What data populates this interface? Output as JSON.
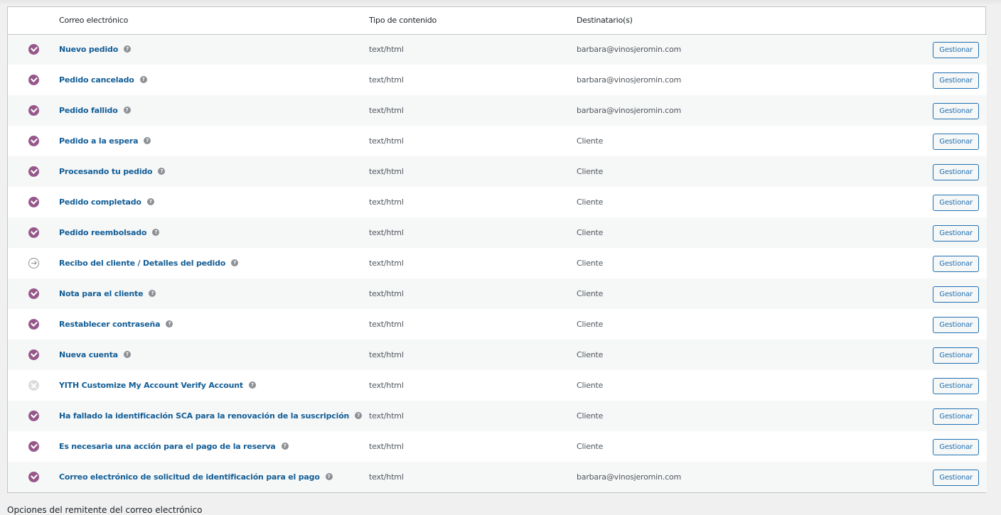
{
  "table": {
    "headers": {
      "status": "",
      "email": "Correo electrónico",
      "type": "Tipo de contenido",
      "recipients": "Destinatario(s)",
      "actions": ""
    },
    "rows": [
      {
        "status": "enabled",
        "name": "Nuevo pedido",
        "type": "text/html",
        "recipient": "barbara@vinosjeromin.com",
        "action": "Gestionar"
      },
      {
        "status": "enabled",
        "name": "Pedido cancelado",
        "type": "text/html",
        "recipient": "barbara@vinosjeromin.com",
        "action": "Gestionar"
      },
      {
        "status": "enabled",
        "name": "Pedido fallido",
        "type": "text/html",
        "recipient": "barbara@vinosjeromin.com",
        "action": "Gestionar"
      },
      {
        "status": "enabled",
        "name": "Pedido a la espera",
        "type": "text/html",
        "recipient": "Cliente",
        "action": "Gestionar"
      },
      {
        "status": "enabled",
        "name": "Procesando tu pedido",
        "type": "text/html",
        "recipient": "Cliente",
        "action": "Gestionar"
      },
      {
        "status": "enabled",
        "name": "Pedido completado",
        "type": "text/html",
        "recipient": "Cliente",
        "action": "Gestionar"
      },
      {
        "status": "enabled",
        "name": "Pedido reembolsado",
        "type": "text/html",
        "recipient": "Cliente",
        "action": "Gestionar"
      },
      {
        "status": "manual",
        "name": "Recibo del cliente / Detalles del pedido",
        "type": "text/html",
        "recipient": "Cliente",
        "action": "Gestionar"
      },
      {
        "status": "enabled",
        "name": "Nota para el cliente",
        "type": "text/html",
        "recipient": "Cliente",
        "action": "Gestionar"
      },
      {
        "status": "enabled",
        "name": "Restablecer contraseña",
        "type": "text/html",
        "recipient": "Cliente",
        "action": "Gestionar"
      },
      {
        "status": "enabled",
        "name": "Nueva cuenta",
        "type": "text/html",
        "recipient": "Cliente",
        "action": "Gestionar"
      },
      {
        "status": "disabled",
        "name": "YITH Customize My Account Verify Account",
        "type": "text/html",
        "recipient": "Cliente",
        "action": "Gestionar"
      },
      {
        "status": "enabled",
        "name": "Ha fallado la identificación SCA para la renovación de la suscripción",
        "type": "text/html",
        "recipient": "Cliente",
        "action": "Gestionar"
      },
      {
        "status": "enabled",
        "name": "Es necesaria una acción para el pago de la reserva",
        "type": "text/html",
        "recipient": "Cliente",
        "action": "Gestionar"
      },
      {
        "status": "enabled",
        "name": "Correo electrónico de solicitud de identificación para el pago",
        "type": "text/html",
        "recipient": "barbara@vinosjeromin.com",
        "action": "Gestionar"
      }
    ]
  },
  "help_glyph": "?",
  "footer": {
    "heading": "Opciones del remitente del correo electrónico"
  },
  "colors": {
    "enabled": "#96588a",
    "link": "#135e96",
    "button": "#2271b1"
  },
  "icons": {
    "enabled": "check-circle-icon",
    "manual": "arrow-right-circle-icon",
    "disabled": "x-circle-icon",
    "help": "help-icon"
  }
}
